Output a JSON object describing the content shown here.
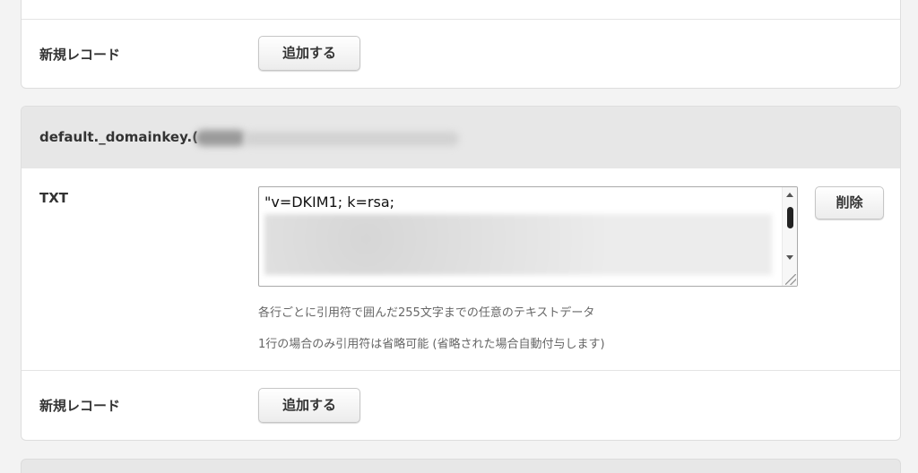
{
  "top_card": {
    "new_record_label": "新規レコード",
    "add_button": "追加する"
  },
  "record_card": {
    "header_title": "default._domainkey.(",
    "record_type": "TXT",
    "txt_value": "\"v=DKIM1; k=rsa;",
    "delete_button": "削除",
    "help_line_1": "各行ごとに引用符で囲んだ255文字までの任意のテキストデータ",
    "help_line_2": "1行の場合のみ引用符は省略可能 (省略された場合自動付与します)",
    "new_record_label": "新規レコード",
    "add_button": "追加する"
  },
  "colors": {
    "page_bg": "#f3f3f3",
    "header_bg": "#e7e7e7",
    "card_bg": "#ffffff"
  }
}
